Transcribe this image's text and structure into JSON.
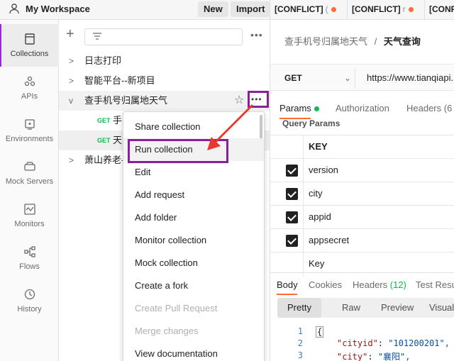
{
  "topbar": {
    "workspace": "My Workspace",
    "new_label": "New",
    "import_label": "Import",
    "tabs": [
      {
        "label": "[CONFLICT]",
        "sub": "("
      },
      {
        "label": "[CONFLICT]",
        "sub": "r"
      },
      {
        "label": "[CONFLICT]",
        "sub": ""
      }
    ]
  },
  "rail": {
    "items": [
      {
        "label": "Collections",
        "icon": "collections-icon",
        "active": true
      },
      {
        "label": "APIs",
        "icon": "apis-icon"
      },
      {
        "label": "Environments",
        "icon": "environments-icon"
      },
      {
        "label": "Mock Servers",
        "icon": "mock-servers-icon"
      },
      {
        "label": "Monitors",
        "icon": "monitors-icon"
      },
      {
        "label": "Flows",
        "icon": "flows-icon"
      },
      {
        "label": "History",
        "icon": "history-icon"
      }
    ]
  },
  "collections": {
    "items": [
      {
        "name": "日志打印",
        "expanded": false
      },
      {
        "name": "智能平台--新项目",
        "expanded": false
      },
      {
        "name": "查手机号归属地天气",
        "expanded": true
      },
      {
        "name": "萧山养老-",
        "expanded": false
      }
    ],
    "requests": [
      {
        "method": "GET",
        "name": "手"
      },
      {
        "method": "GET",
        "name": "天"
      }
    ]
  },
  "menu": {
    "items": [
      {
        "label": "Share collection",
        "disabled": false
      },
      {
        "label": "Run collection",
        "disabled": false
      },
      {
        "label": "Edit",
        "disabled": false
      },
      {
        "label": "Add request",
        "disabled": false
      },
      {
        "label": "Add folder",
        "disabled": false
      },
      {
        "label": "Monitor collection",
        "disabled": false
      },
      {
        "label": "Mock collection",
        "disabled": false
      },
      {
        "label": "Create a fork",
        "disabled": false
      },
      {
        "label": "Create Pull Request",
        "disabled": true
      },
      {
        "label": "Merge changes",
        "disabled": true
      },
      {
        "label": "View documentation",
        "disabled": false
      }
    ]
  },
  "request": {
    "breadcrumb_parent": "查手机号归属地天气",
    "breadcrumb_sep": "/",
    "breadcrumb_current": "天气查询",
    "method": "GET",
    "url": "https://www.tianqiapi.",
    "tabs": {
      "params": "Params",
      "authorization": "Authorization",
      "headers": "Headers (6"
    },
    "query_params_label": "Query Params",
    "key_header": "KEY",
    "params": [
      "version",
      "city",
      "appid",
      "appsecret"
    ],
    "key_placeholder": "Key"
  },
  "response": {
    "tabs": {
      "body": "Body",
      "cookies": "Cookies",
      "headers": "Headers",
      "headers_count": "(12)",
      "test_results": "Test Resu"
    },
    "views": {
      "pretty": "Pretty",
      "raw": "Raw",
      "preview": "Preview",
      "visualize": "Visual"
    },
    "lines": [
      {
        "n": "1",
        "text": "{"
      },
      {
        "n": "2",
        "key": "\"cityid\"",
        "value": "\"101200201\","
      },
      {
        "n": "3",
        "key": "\"city\"",
        "value": "\"襄阳\","
      }
    ]
  },
  "colors": {
    "accent": "#ff6c37",
    "highlight_box": "#8a1f9c",
    "arrow": "#e8392f",
    "get": "#0cbb52"
  }
}
